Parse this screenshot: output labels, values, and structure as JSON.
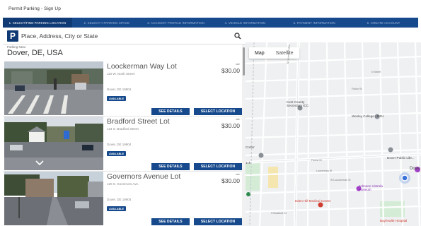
{
  "header": {
    "title": "Permit Parking - Sign Up"
  },
  "steps": [
    {
      "label": "1. Select/Find Parking Location",
      "active": true
    },
    {
      "label": "2. Select a Parking Space",
      "active": false
    },
    {
      "label": "3. Account Profile Information",
      "active": false
    },
    {
      "label": "4. Vehicle Information",
      "active": false
    },
    {
      "label": "5. Payment Information",
      "active": false
    },
    {
      "label": "6. Create Account",
      "active": false
    }
  ],
  "search": {
    "logo": "P",
    "placeholder": "Place, Address, City or State",
    "value": "",
    "icon": "search-icon"
  },
  "location": {
    "label": "Parking Near",
    "value": "Dover, DE, USA"
  },
  "lots": [
    {
      "name": "Loockerman Way Lot",
      "address": "110 W. North Street",
      "city": "Dover, DE 19904",
      "rate_label": "rate",
      "price": "$30.00",
      "status": "AVAILABLE",
      "details_label": "SEE DETAILS",
      "select_label": "SELECT LOCATION"
    },
    {
      "name": "Bradford Street Lot",
      "address": "124 S. Bradford Street",
      "city": "Dover, DE 19904",
      "rate_label": "rate",
      "price": "$30.00",
      "status": "AVAILABLE",
      "details_label": "SEE DETAILS",
      "select_label": "SELECT LOCATION"
    },
    {
      "name": "Governors Avenue Lot",
      "address": "120 S. Governors Ave.",
      "city": "Dover, DE 19904",
      "rate_label": "rate",
      "price": "$30.00",
      "status": "AVAILABLE",
      "details_label": "SEE DETAILS",
      "select_label": "SELECT LOCATION"
    }
  ],
  "map": {
    "tabs": [
      "Map",
      "Satellite"
    ],
    "active_tab": "Map",
    "labels": {
      "kent_county": "Kent County\nSecondary ICC",
      "wesley": "Wesley College - DSU",
      "dover_public": "Dover Public Libr...",
      "dover": "Dove",
      "johnson": "Johnson Victrola\nMuseum",
      "eden_hill": "Eden Hill Medical Center",
      "bayhealth": "Bayhealth Hospital",
      "cortor": "Cortor",
      "forest_st": "Forest St",
      "lockerman": "Lockerman St",
      "ick": "1ck",
      "n_gov": "N Governors Ave",
      "fulton": "Fulton St",
      "n_street": "N Street",
      "w_loockerman": "W Loockerman St",
      "s_bradford": "S Bradford St"
    },
    "colors": {
      "road": "#ffffff",
      "major_road": "#f7d98b",
      "water": "#aadaff",
      "park": "#d4ecd6",
      "marker": "#3b72d9"
    }
  }
}
